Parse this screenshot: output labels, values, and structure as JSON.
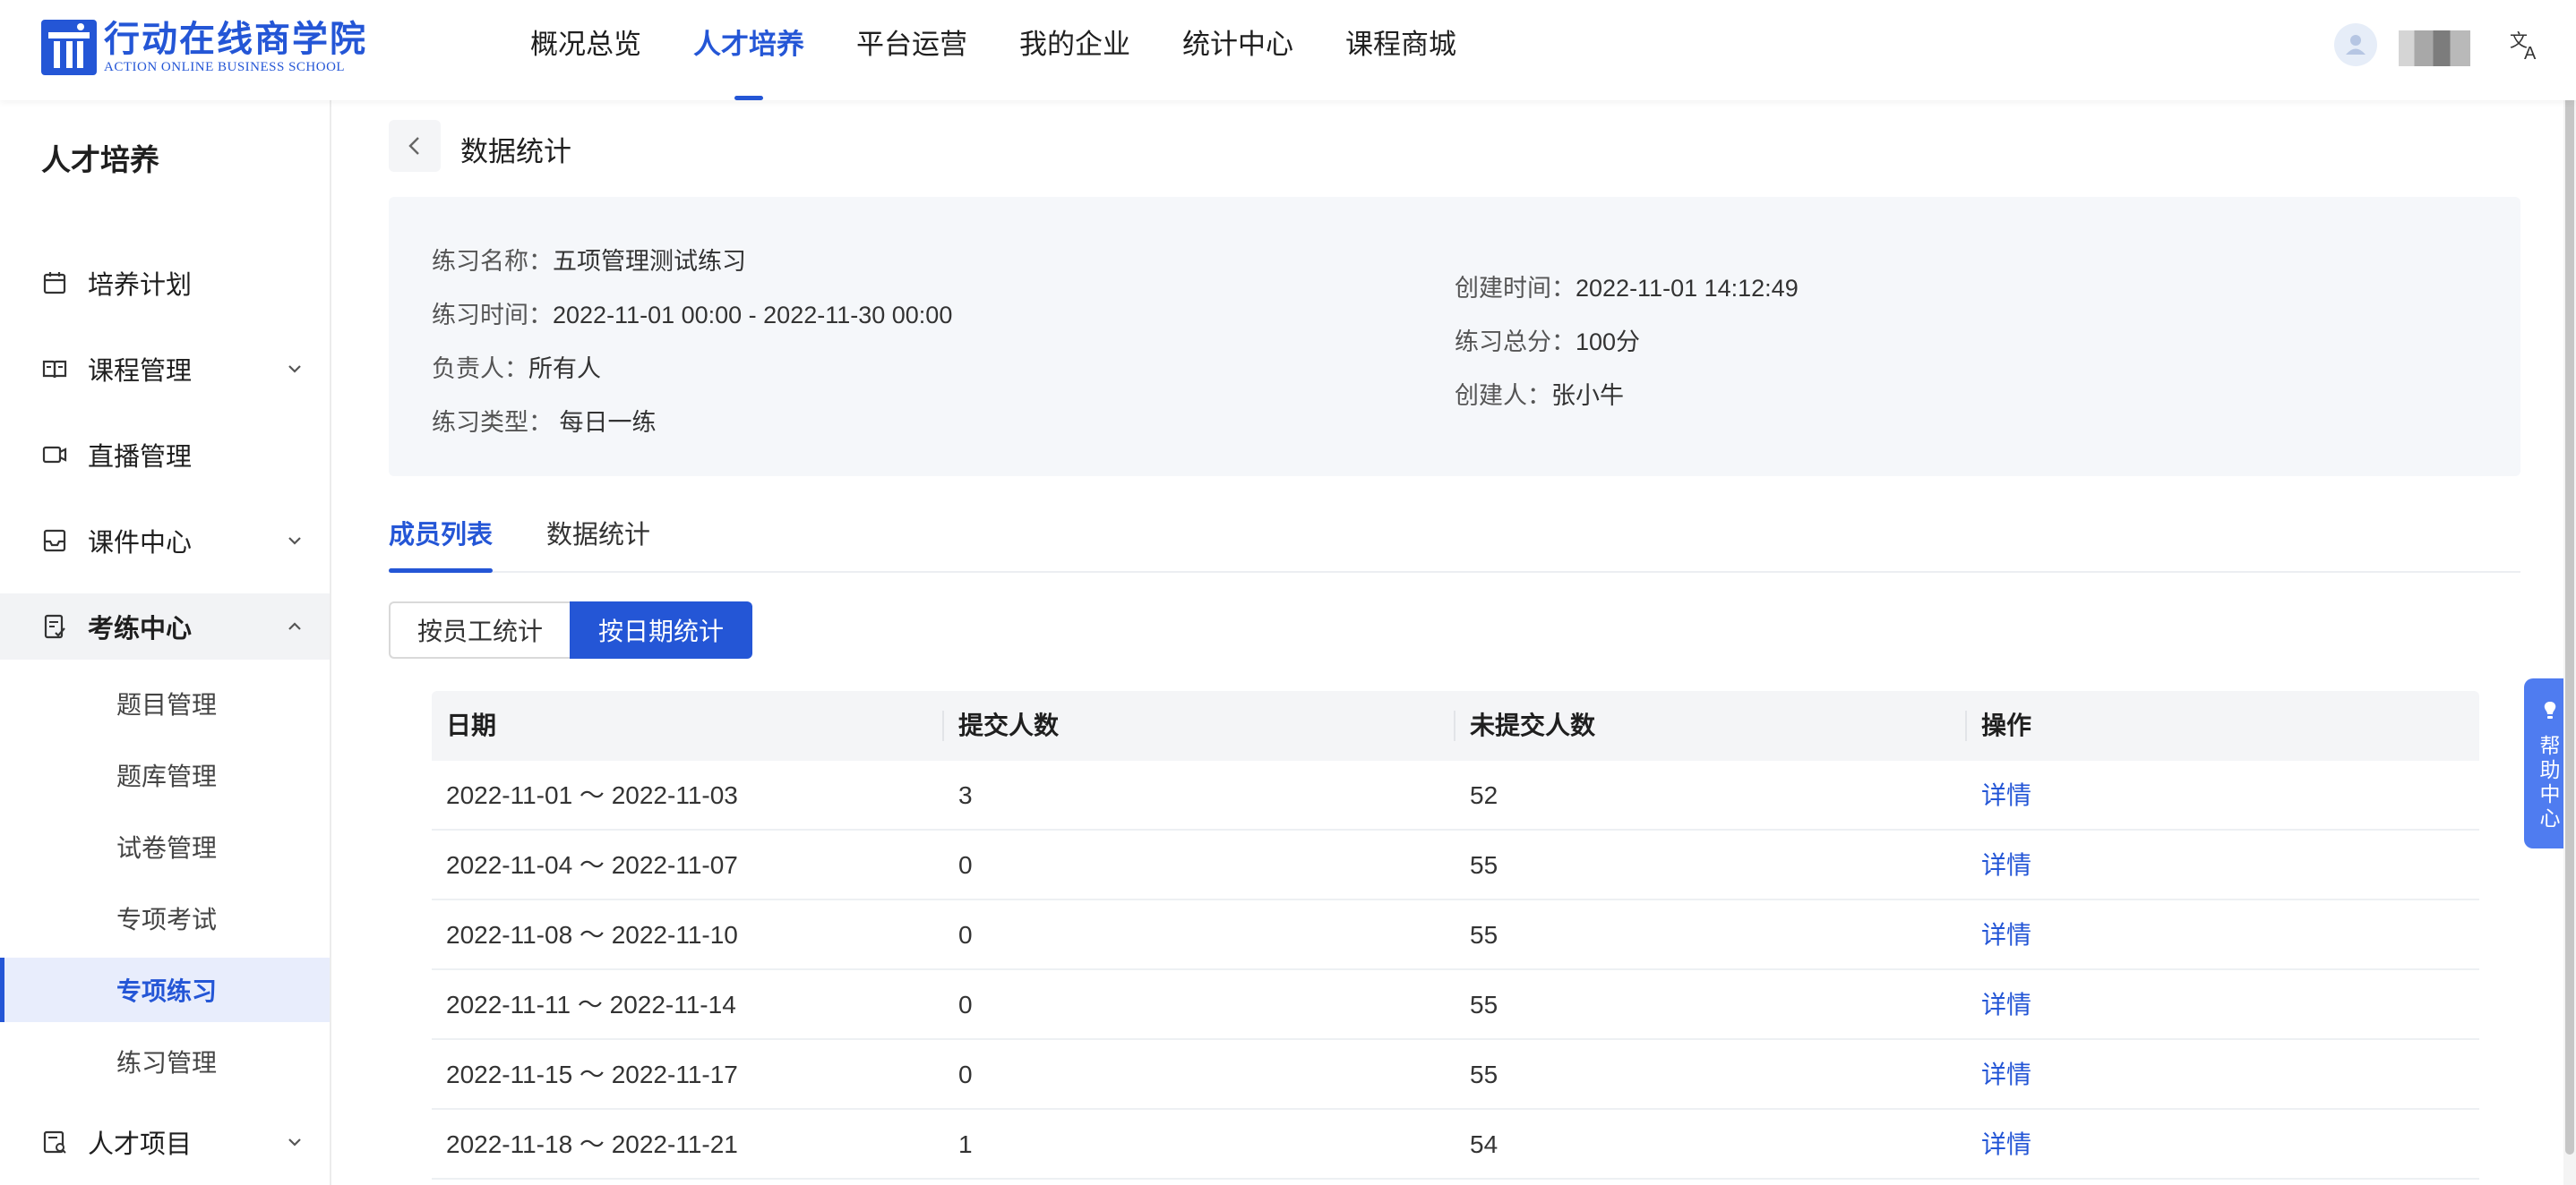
{
  "brand": {
    "name_cn": "行动在线商学院",
    "name_en": "ACTION ONLINE BUSINESS SCHOOL",
    "color": "#2456d6"
  },
  "nav": {
    "items": [
      "概况总览",
      "人才培养",
      "平台运营",
      "我的企业",
      "统计中心",
      "课程商城"
    ],
    "active": "人才培养"
  },
  "sidebar": {
    "title": "人才培养",
    "items": [
      {
        "label": "培养计划",
        "icon": "calendar-icon"
      },
      {
        "label": "课程管理",
        "icon": "book-icon",
        "has_children": true
      },
      {
        "label": "直播管理",
        "icon": "video-icon"
      },
      {
        "label": "课件中心",
        "icon": "inbox-icon",
        "has_children": true
      },
      {
        "label": "考练中心",
        "icon": "exam-icon",
        "has_children": true,
        "expanded": true
      },
      {
        "label": "人才项目",
        "icon": "project-icon",
        "has_children": true
      }
    ],
    "sub_items": [
      "题目管理",
      "题库管理",
      "试卷管理",
      "专项考试",
      "专项练习",
      "练习管理"
    ],
    "active_sub": "专项练习"
  },
  "page": {
    "title": "数据统计"
  },
  "info": {
    "name_label": "练习名称：",
    "name_value": "五项管理测试练习",
    "time_label": "练习时间：",
    "time_value": "2022-11-01 00:00 - 2022-11-30 00:00",
    "owner_label": "负责人：",
    "owner_value": "所有人",
    "type_label": "练习类型：",
    "type_value": " 每日一练",
    "created_label": "创建时间：",
    "created_value": "2022-11-01 14:12:49",
    "score_label": "练习总分：",
    "score_value": "100分",
    "creator_label": "创建人：",
    "creator_value": "张小牛"
  },
  "tabs": {
    "members": "成员列表",
    "stats": "数据统计",
    "active": "成员列表"
  },
  "segments": {
    "by_employee": "按员工统计",
    "by_date": "按日期统计",
    "active": "按日期统计"
  },
  "table": {
    "headers": [
      "日期",
      "提交人数",
      "未提交人数",
      "操作"
    ],
    "rows": [
      {
        "date": "2022-11-01 ～ 2022-11-03",
        "submitted": "3",
        "unsubmitted": "52",
        "action": "详情"
      },
      {
        "date": "2022-11-04 ～ 2022-11-07",
        "submitted": "0",
        "unsubmitted": "55",
        "action": "详情"
      },
      {
        "date": "2022-11-08 ～ 2022-11-10",
        "submitted": "0",
        "unsubmitted": "55",
        "action": "详情"
      },
      {
        "date": "2022-11-11 ～ 2022-11-14",
        "submitted": "0",
        "unsubmitted": "55",
        "action": "详情"
      },
      {
        "date": "2022-11-15 ～ 2022-11-17",
        "submitted": "0",
        "unsubmitted": "55",
        "action": "详情"
      },
      {
        "date": "2022-11-18 ～ 2022-11-21",
        "submitted": "1",
        "unsubmitted": "54",
        "action": "详情"
      }
    ]
  },
  "help": {
    "label": "帮助中心",
    "icon": "lightbulb-icon",
    "color": "#4f7cf0"
  },
  "colors": {
    "accent": "#2456d6",
    "panel_bg": "#f5f7fa",
    "active_sub_bg": "#e8edfc"
  }
}
